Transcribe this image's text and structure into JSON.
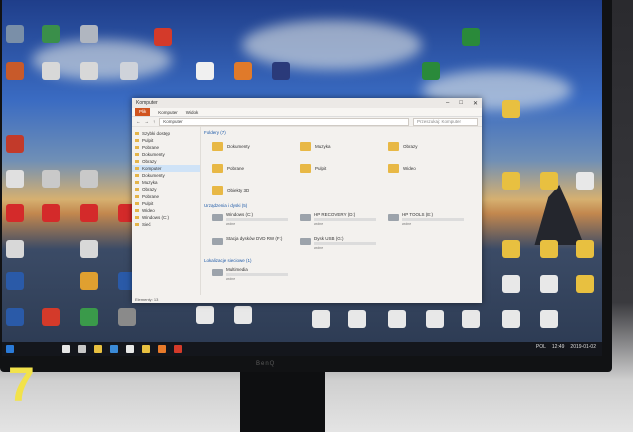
{
  "window": {
    "title": "Komputer",
    "ribbon_tabs": [
      "Plik",
      "Komputer",
      "Widok"
    ],
    "address_path": "Komputer",
    "search_placeholder": "Przeszukaj: Komputer"
  },
  "nav": {
    "items": [
      "Szybki dostęp",
      "Pulpit",
      "Pobrane",
      "Dokumenty",
      "Obrazy",
      "Komputer",
      "Dokumenty",
      "Muzyka",
      "Obrazy",
      "Pobrane",
      "Pulpit",
      "Wideo",
      "Windows (C:)",
      "Sieć"
    ],
    "selected_index": 5
  },
  "content": {
    "folders_header": "Foldery (7)",
    "folders": [
      "Dokumenty",
      "Muzyka",
      "Obrazy",
      "Pobrane",
      "Pulpit",
      "Wideo",
      "Obiekty 3D"
    ],
    "devices_header": "Urządzenia i dyski (5)",
    "drives": [
      {
        "name": "Windows (C:)",
        "usage": 0.55,
        "sub": "wolne"
      },
      {
        "name": "HP RECOVERY (D:)",
        "usage": 0.9,
        "sub": "wolne"
      },
      {
        "name": "HP TOOLS (E:)",
        "usage": 0.35,
        "sub": "wolne"
      },
      {
        "name": "Stacja dysków DVD RW (F:)",
        "usage": 0,
        "sub": ""
      },
      {
        "name": "Dysk USB (G:)",
        "usage": 0.6,
        "sub": "wolne"
      }
    ],
    "network_header": "Lokalizacje sieciowe (1)",
    "network": [
      {
        "name": "Multimedia",
        "usage": 0.7,
        "sub": "wolne"
      }
    ]
  },
  "status": "Elementy: 13",
  "taskbar": {
    "time": "12:49",
    "date": "2019-01-02",
    "lang": "POL"
  },
  "monitor_brand": "BenQ",
  "overlay_number": "7",
  "colors": {
    "accent": "#2a78d2",
    "folder": "#e8b845",
    "badge": "#f2e24a"
  }
}
